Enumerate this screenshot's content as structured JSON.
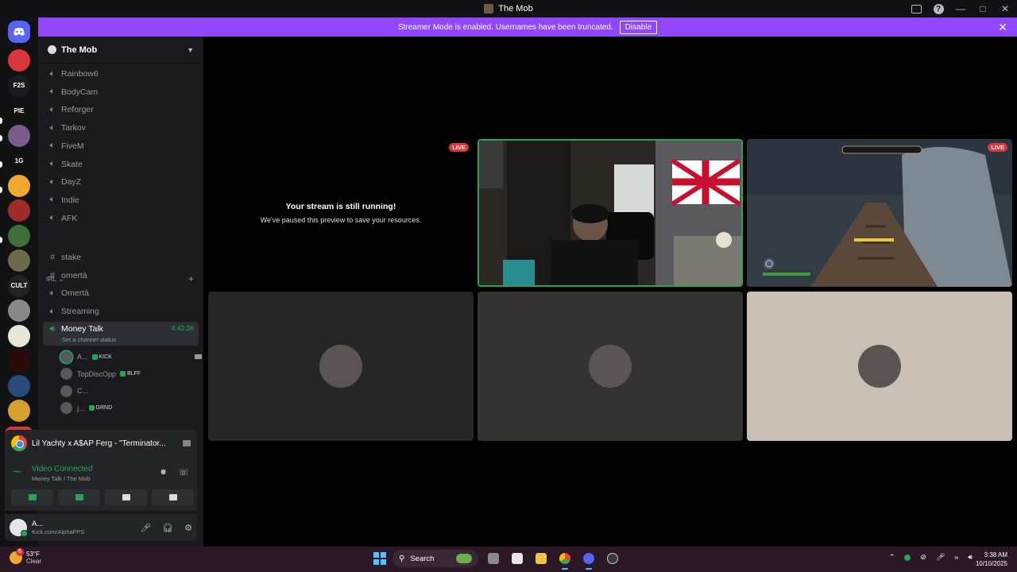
{
  "window": {
    "title": "The Mob"
  },
  "banner": {
    "text": "Streamer Mode is enabled. Usernames have been truncated.",
    "disable_label": "Disable"
  },
  "rail": {
    "new_badge": "NEW",
    "servers": [
      {
        "label": "",
        "color": "#da373c"
      },
      {
        "label": "F2S",
        "color": "#1a1a1e"
      },
      {
        "label": "PIE",
        "color": "#111"
      },
      {
        "label": "",
        "color": "#7a5c8a"
      },
      {
        "label": "1G",
        "color": "#111"
      },
      {
        "label": "",
        "color": "#f0a830"
      },
      {
        "label": "",
        "color": "#9c2b2b"
      },
      {
        "label": "",
        "color": "#3f6e3a"
      },
      {
        "label": "",
        "color": "#6a6a4a"
      },
      {
        "label": "CULT",
        "color": "#222"
      },
      {
        "label": "",
        "color": "#888"
      },
      {
        "label": "",
        "color": "#e8e8d8"
      },
      {
        "label": "",
        "color": "#2a0a0a"
      },
      {
        "label": "",
        "color": "#2a4a7a"
      },
      {
        "label": "",
        "color": "#d4a030"
      }
    ]
  },
  "guild": {
    "name": "The Mob",
    "voice_channels": [
      "Rainbow6",
      "BodyCam",
      "Reforger",
      "Tarkov",
      "FiveM",
      "Skate",
      "DayZ",
      "Indie",
      "AFK"
    ],
    "category": "IRL",
    "irl_channels": [
      {
        "name": "stake",
        "type": "text"
      },
      {
        "name": "omertà",
        "type": "text"
      },
      {
        "name": "Omertà",
        "type": "voice"
      },
      {
        "name": "Streaming",
        "type": "voice"
      }
    ],
    "active_channel": {
      "name": "Money Talk",
      "timer": "4:42:36",
      "status": "Set a channel status"
    },
    "voice_users": [
      {
        "name": "A...",
        "tag": "KICK",
        "live": "LIVE",
        "camera": true
      },
      {
        "name": "TopDiscOpp",
        "tag": "BLFF",
        "live": "LIVE",
        "camera": false
      },
      {
        "name": "C...",
        "tag": "",
        "live": "",
        "camera": false
      },
      {
        "name": "j...",
        "tag": "GRND",
        "live": "",
        "camera": false
      }
    ]
  },
  "activity": {
    "title": "Lil Yachty x A$AP Ferg - \"Terminator..."
  },
  "voice": {
    "status": "Video Connected",
    "location": "Money Talk / The Mob"
  },
  "user": {
    "name": "A...",
    "status": "Kick.com/AlphaFPS"
  },
  "stage": {
    "paused_title": "Your stream is still running!",
    "paused_sub": "We've paused this preview to save your resources.",
    "live_label": "LIVE",
    "user_tiles": [
      {
        "bg": "#262626"
      },
      {
        "bg": "#353330"
      },
      {
        "bg": "#c8c0b4"
      }
    ]
  },
  "taskbar": {
    "weather_temp": "53°F",
    "weather_cond": "Clear",
    "weather_count": "6",
    "search_label": "Search",
    "time": "3:38 AM",
    "date": "10/10/2025"
  }
}
